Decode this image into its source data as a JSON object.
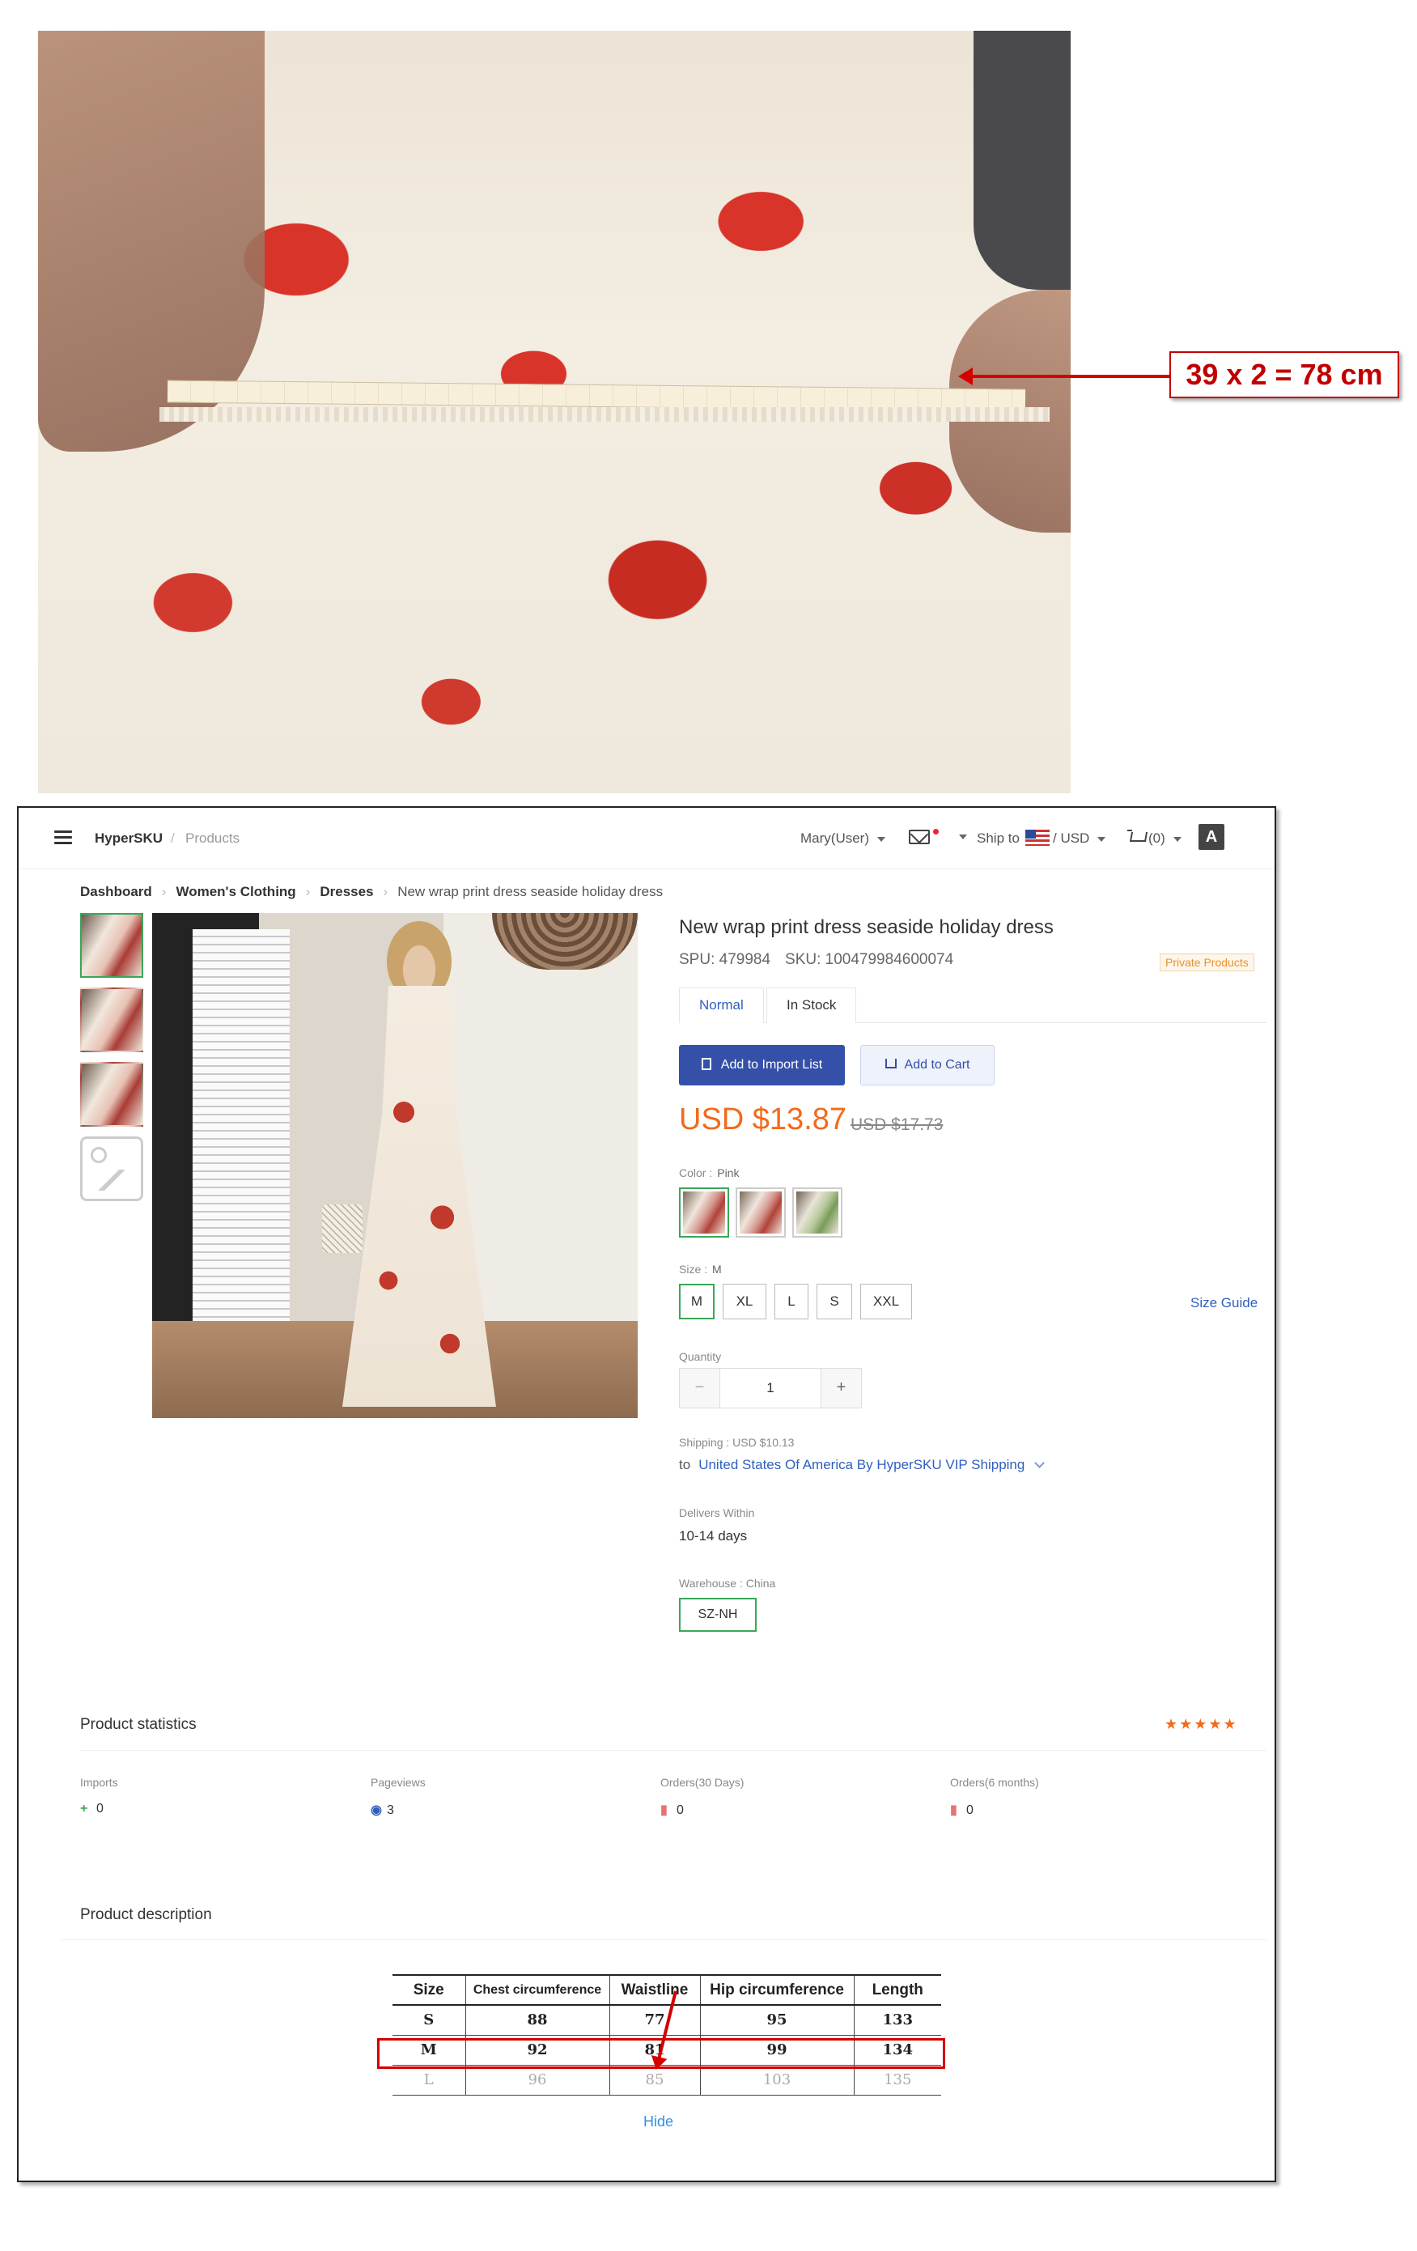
{
  "measurement": {
    "annotation": "39 x 2 = 78 cm",
    "accent_color": "#d40000"
  },
  "header": {
    "brand": "HyperSKU",
    "separator": "/",
    "section": "Products",
    "user": "Mary(User)",
    "ship_to": "Ship to",
    "currency": "/ USD",
    "cart": "(0)",
    "lang_glyph": "A"
  },
  "breadcrumb": {
    "items": [
      "Dashboard",
      "Women's Clothing",
      "Dresses",
      "New wrap print dress seaside holiday dress"
    ]
  },
  "product": {
    "title": "New wrap print dress seaside holiday dress",
    "spu": "SPU: 479984",
    "sku": "SKU: 100479984600074",
    "tag": "Private Products",
    "tabs": [
      "Normal",
      "In Stock"
    ],
    "add_import": "Add to Import List",
    "add_cart": "Add to Cart",
    "price": "USD $13.87",
    "old_price": "USD $17.73",
    "price_color": "#f26a1b",
    "color_label": "Color :",
    "color_value": "Pink",
    "size_label": "Size :",
    "size_value": "M",
    "sizes": [
      "M",
      "XL",
      "L",
      "S",
      "XXL"
    ],
    "size_guide": "Size Guide",
    "quantity_label": "Quantity",
    "quantity": "1",
    "minus": "−",
    "plus": "+",
    "shipping_label": "Shipping :",
    "shipping_value": "USD $10.13",
    "to": "to",
    "ship_route": "United States Of America By HyperSKU VIP Shipping",
    "delivers_label": "Delivers Within",
    "delivers_value": "10-14 days",
    "warehouse_label": "Warehouse :",
    "warehouse_value": "China",
    "warehouse_code": "SZ-NH"
  },
  "stats": {
    "title": "Product statistics",
    "stars": "★★★★★",
    "items": [
      {
        "label": "Imports",
        "value": "0",
        "icon": "+"
      },
      {
        "label": "Pageviews",
        "value": "3",
        "icon": "◉"
      },
      {
        "label": "Orders(30 Days)",
        "value": "0",
        "icon": "▮"
      },
      {
        "label": "Orders(6 months)",
        "value": "0",
        "icon": "▮"
      }
    ]
  },
  "description": {
    "title": "Product description",
    "table": {
      "headers": [
        "Size",
        "Chest circumference",
        "Waistline",
        "Hip circumference",
        "Length"
      ],
      "rows": [
        [
          "S",
          "88",
          "77",
          "95",
          "133"
        ],
        [
          "M",
          "92",
          "81",
          "99",
          "134"
        ],
        [
          "L",
          "96",
          "85",
          "103",
          "135"
        ]
      ]
    },
    "hide": "Hide"
  }
}
